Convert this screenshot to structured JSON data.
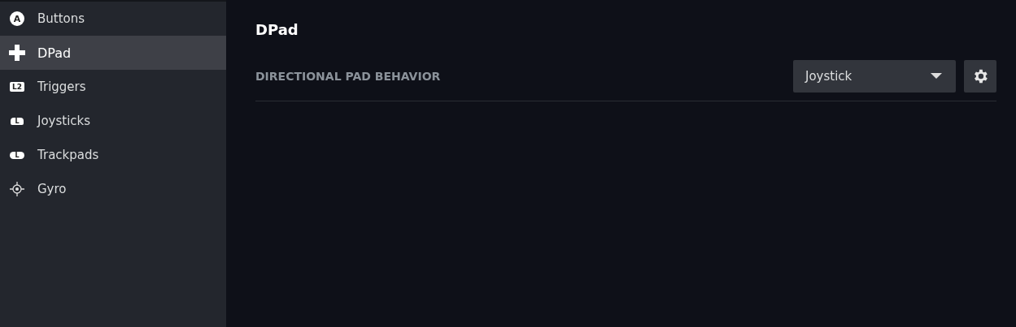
{
  "sidebar": {
    "items": [
      {
        "label": "Buttons",
        "kind": "circle",
        "icon_text": "A",
        "selected": false
      },
      {
        "label": "DPad",
        "kind": "cross",
        "selected": true
      },
      {
        "label": "Triggers",
        "kind": "trigger",
        "icon_text": "L2",
        "selected": false
      },
      {
        "label": "Joysticks",
        "kind": "stick",
        "icon_text": "L",
        "selected": false
      },
      {
        "label": "Trackpads",
        "kind": "pad",
        "icon_text": "L",
        "selected": false
      },
      {
        "label": "Gyro",
        "kind": "gyro",
        "selected": false
      }
    ]
  },
  "page": {
    "title": "DPad",
    "setting": {
      "label": "DIRECTIONAL PAD BEHAVIOR",
      "value": "Joystick"
    }
  }
}
